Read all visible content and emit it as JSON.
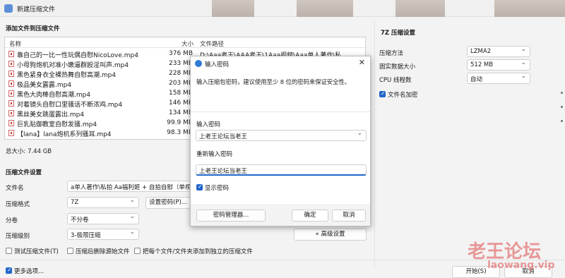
{
  "window": {
    "title": "新建压缩文件"
  },
  "files_section": {
    "title": "添加文件到压缩文件",
    "headers": {
      "name": "名称",
      "size": "大小",
      "path": "文件路径"
    },
    "rows": [
      {
        "name": "靠自己的一比一性玩偶自慰NicoLove.mp4",
        "size": "376 MB",
        "path": "D:\\Aaa老王\\AAA老王\\1Aaa视频\\Aaa单人著作\\私..."
      },
      {
        "name": "小母狗炮机对准小嫩逼群殴淫叫声.mp4",
        "size": "233 MB",
        "path": ""
      },
      {
        "name": "黑色紧身衣全裸热舞自慰高潮.mp4",
        "size": "228 MB",
        "path": ""
      },
      {
        "name": "极品美女露露.mp4",
        "size": "203 MB",
        "path": ""
      },
      {
        "name": "黑色大肉棒自慰高潮.mp4",
        "size": "158 MB",
        "path": ""
      },
      {
        "name": "对着镜头自慰口里骚话不断浓鸡.mp4",
        "size": "146 MB",
        "path": ""
      },
      {
        "name": "黑丝美女跳蛋露出.mp4",
        "size": "134 MB",
        "path": ""
      },
      {
        "name": "巨乳贴御教室自慰发骚.mp4",
        "size": "99.9 MB",
        "path": ""
      },
      {
        "name": "【lana】lana炮机系列骚耳.mp4",
        "size": "98.3 MB",
        "path": ""
      }
    ],
    "total": "总大小: 7.44 GB"
  },
  "compress_settings": {
    "title": "压缩文件设置",
    "filename_label": "文件名",
    "filename_value": "a单人著作\\私拍  Aa福利姬 + 自拍自慰（单视频）",
    "format_label": "压缩格式",
    "format_value": "7Z",
    "set_password_btn": "设置密码(P)...",
    "split_label": "分卷",
    "split_value": "不分卷",
    "level_label": "压缩级别",
    "level_value": "3-极限压缩",
    "advanced_btn": "« 高级设置",
    "check_test": "测试压缩文件(T)",
    "check_delete": "压缩后删除源始文件",
    "check_separate": "把每个文件/文件夹添加到独立的压缩文件",
    "more_options": "更多选项..."
  },
  "sevenz_settings": {
    "title": "7Z 压缩设置",
    "method_label": "压缩方法",
    "method_value": "LZMA2",
    "dict_label": "固实数据大小",
    "dict_value": "512 MB",
    "cpu_label": "CPU 线程数",
    "cpu_value": "自动",
    "encrypt_names": "文件名加密"
  },
  "footer": {
    "start_btn": "开始(S)",
    "cancel_btn": "取消"
  },
  "dialog": {
    "title": "输入密码",
    "hint": "输入压缩包密码，建议使用至少 8 位的密码来保证安全性。",
    "enter_label": "输入密码",
    "enter_value": "上老王论坛当老王",
    "reenter_label": "重新输入密码",
    "reenter_value": "上老王论坛当老王",
    "show_password": "显示密码",
    "manager_btn": "密码管理器...",
    "ok_btn": "确定",
    "cancel_btn": "取消"
  },
  "watermark": {
    "text": "老王论坛",
    "url": "laowang.vip"
  }
}
